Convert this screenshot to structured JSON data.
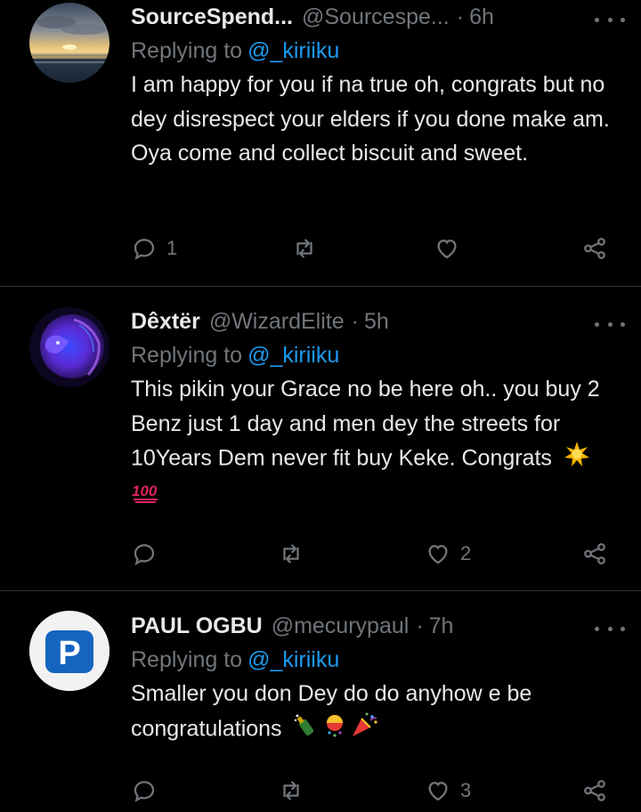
{
  "tweets": [
    {
      "display_name": "SourceSpend...",
      "handle": "@Sourcespe...",
      "separator": "·",
      "time": "6h",
      "replying_prefix": "Replying to",
      "replying_to": "@_kiriiku",
      "text": "I am happy for you if na true oh, congrats but no dey disrespect your elders if you done make am. Oya come and collect biscuit and sweet.",
      "reply_count": "1",
      "retweet_count": "",
      "like_count": "",
      "avatar": "sunset-sea-avatar"
    },
    {
      "display_name": "Dêxtër",
      "handle": "@WizardElite",
      "separator": "·",
      "time": "5h",
      "replying_prefix": "Replying to",
      "replying_to": "@_kiriiku",
      "text": "This pikin your Grace no be here oh.. you buy 2 Benz just 1 day and men dey the streets for 10Years Dem never fit buy Keke. Congrats",
      "emojis": "sun-emoji, hundred-points-emoji",
      "reply_count": "",
      "retweet_count": "",
      "like_count": "2",
      "avatar": "purple-lion-avatar"
    },
    {
      "display_name": "PAUL OGBU",
      "handle": "@mecurypaul",
      "separator": "·",
      "time": "7h",
      "replying_prefix": "Replying to",
      "replying_to": "@_kiriiku",
      "text": "Smaller you don Dey do do anyhow e be congratulations",
      "emojis": "champagne-emoji, confetti-ball-emoji, party-popper-emoji",
      "reply_count": "",
      "retweet_count": "",
      "like_count": "3",
      "avatar": "letter-p-avatar",
      "avatar_letter": "P"
    }
  ],
  "colors": {
    "background": "#000000",
    "text": "#e7e9ea",
    "muted": "#71767b",
    "link": "#1d9bf0",
    "divider": "#2f3336",
    "p_avatar_blue": "#1565c0"
  }
}
